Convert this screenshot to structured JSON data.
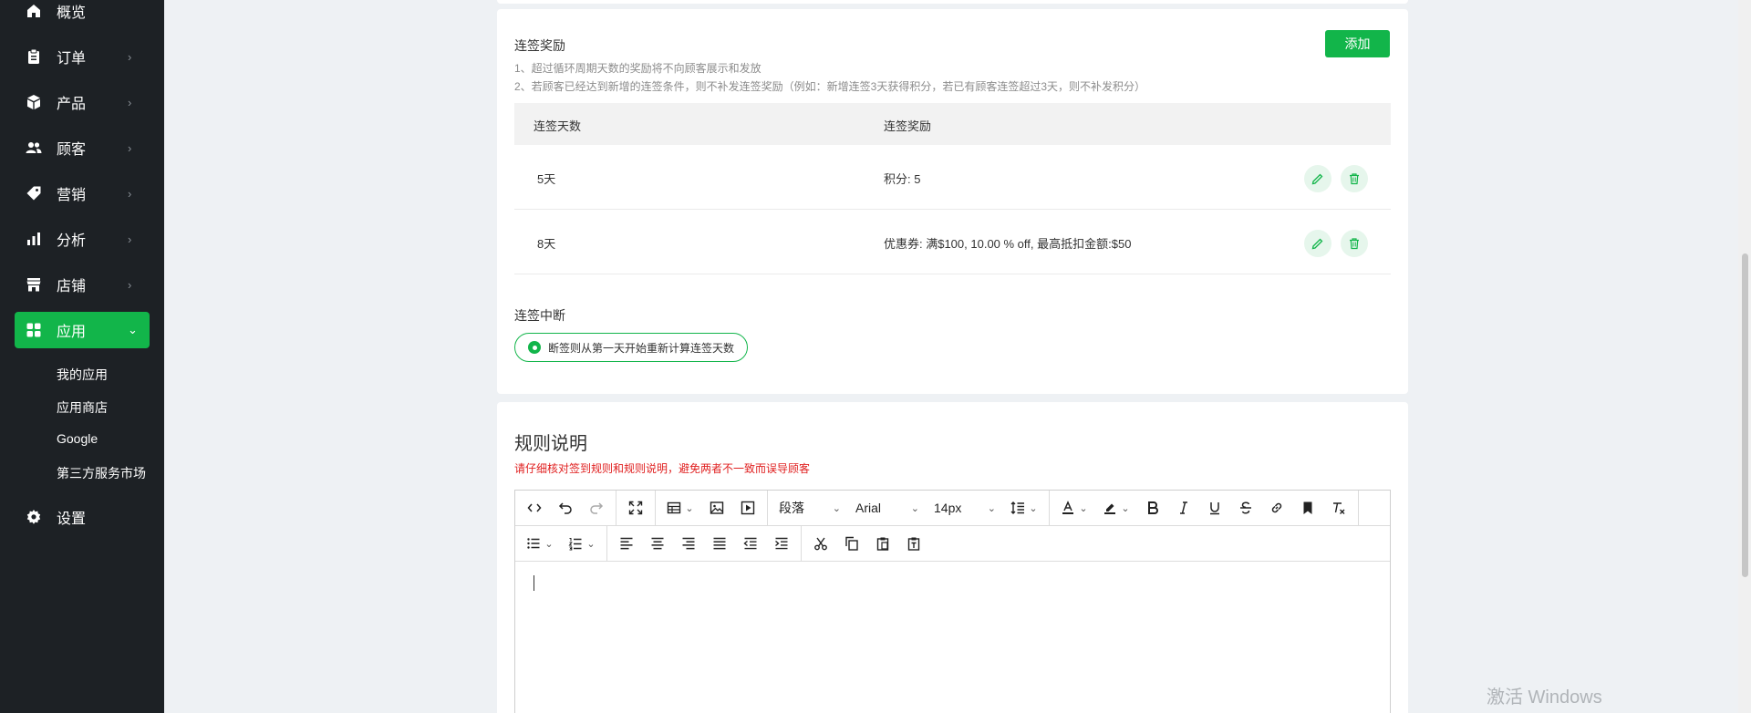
{
  "sidebar": {
    "items": [
      {
        "label": "概览",
        "icon": "home-icon"
      },
      {
        "label": "订单",
        "icon": "clipboard-icon"
      },
      {
        "label": "产品",
        "icon": "box-icon"
      },
      {
        "label": "顾客",
        "icon": "users-icon"
      },
      {
        "label": "营销",
        "icon": "tag-icon"
      },
      {
        "label": "分析",
        "icon": "bar-chart-icon"
      },
      {
        "label": "店铺",
        "icon": "store-icon"
      },
      {
        "label": "应用",
        "icon": "apps-icon"
      },
      {
        "label": "设置",
        "icon": "gear-icon"
      }
    ],
    "active_index": 7,
    "sub_items": [
      "我的应用",
      "应用商店",
      "Google",
      "第三方服务市场"
    ],
    "accent_color": "#12b54a"
  },
  "streak": {
    "title": "连签奖励",
    "notes": [
      "1、超过循环周期天数的奖励将不向顾客展示和发放",
      "2、若顾客已经达到新增的连签条件，则不补发连签奖励（例如：新增连签3天获得积分，若已有顾客连签超过3天，则不补发积分）"
    ],
    "add_label": "添加",
    "columns": [
      "连签天数",
      "连签奖励"
    ],
    "rows": [
      {
        "days": "5天",
        "reward": "积分:   5"
      },
      {
        "days": "8天",
        "reward": "优惠券:   满$100,  10.00 % off,  最高抵扣金额:$50"
      }
    ],
    "break_title": "连签中断",
    "break_option": "断签则从第一天开始重新计算连签天数"
  },
  "rules": {
    "title": "规则说明",
    "warning": "请仔细核对签到规则和规则说明，避免两者不一致而误导顾客",
    "warning_color": "#e02020",
    "toolbar": {
      "paragraph": "段落",
      "font": "Arial",
      "size": "14px"
    }
  },
  "watermark": "激活 Windows"
}
